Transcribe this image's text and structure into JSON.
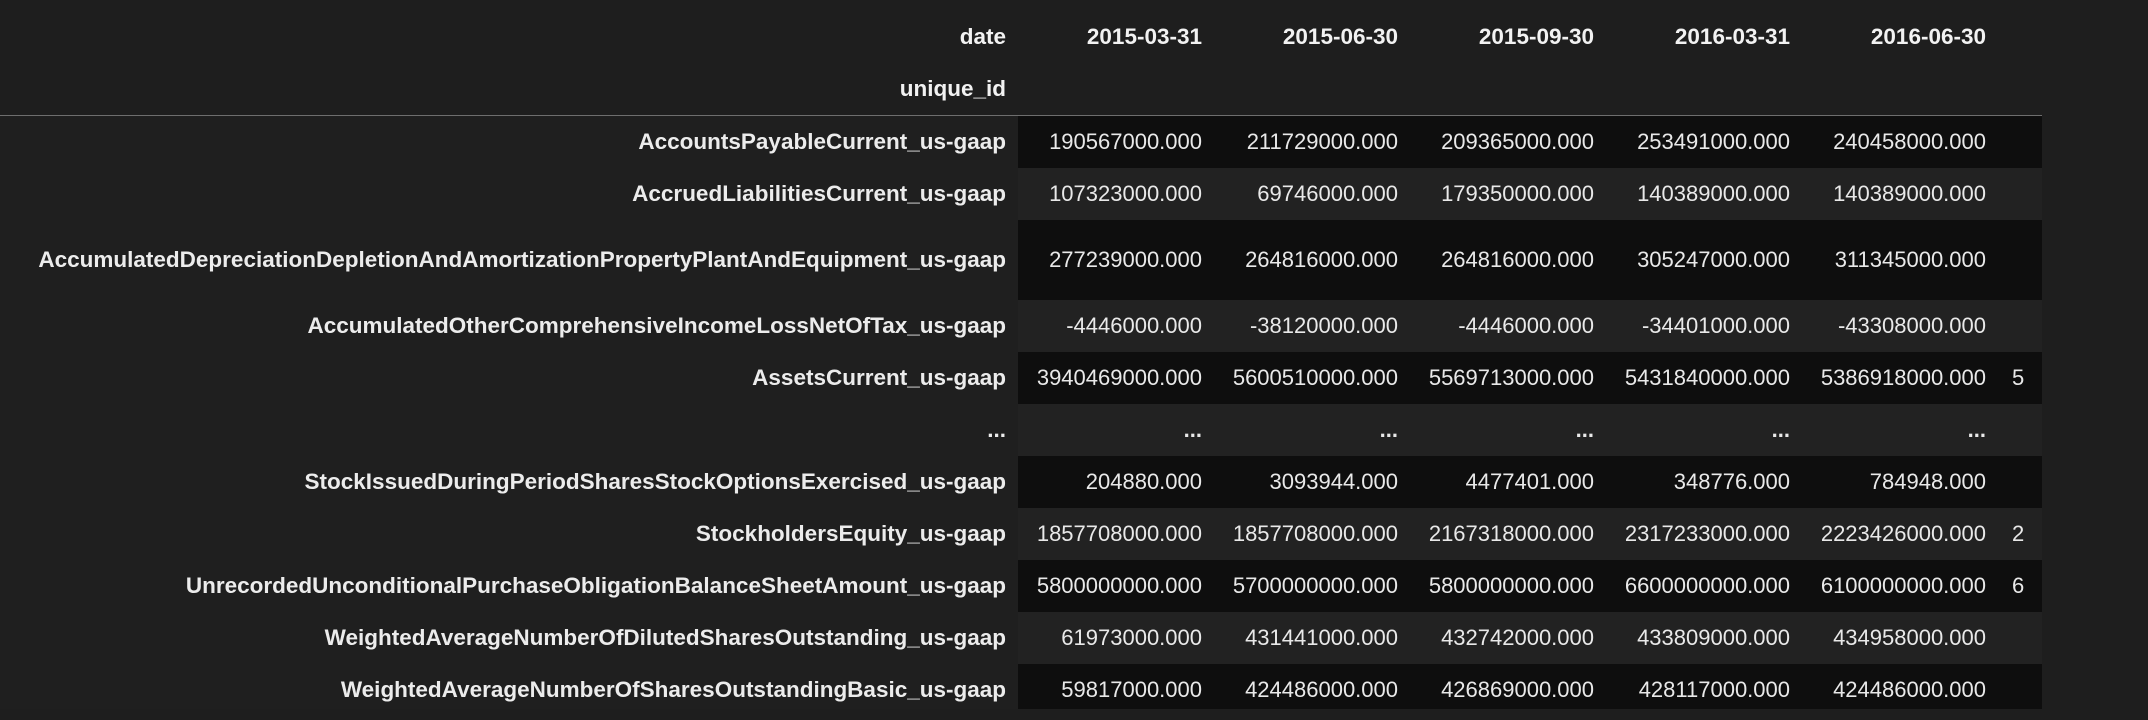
{
  "table": {
    "columns_name": "date",
    "index_name": "unique_id",
    "columns": [
      "2015-03-31",
      "2015-06-30",
      "2015-09-30",
      "2016-03-31",
      "2016-06-30"
    ],
    "rows": [
      {
        "label": "AccountsPayableCurrent_us-gaap",
        "values": [
          "190567000.000",
          "211729000.000",
          "209365000.000",
          "253491000.000",
          "240458000.000"
        ],
        "clipped": ""
      },
      {
        "label": "AccruedLiabilitiesCurrent_us-gaap",
        "values": [
          "107323000.000",
          "69746000.000",
          "179350000.000",
          "140389000.000",
          "140389000.000"
        ],
        "clipped": ""
      },
      {
        "label": "AccumulatedDepreciationDepletionAndAmortizationPropertyPlantAndEquipment_us-gaap",
        "values": [
          "277239000.000",
          "264816000.000",
          "264816000.000",
          "305247000.000",
          "311345000.000"
        ],
        "clipped": ""
      },
      {
        "label": "AccumulatedOtherComprehensiveIncomeLossNetOfTax_us-gaap",
        "values": [
          "-4446000.000",
          "-38120000.000",
          "-4446000.000",
          "-34401000.000",
          "-43308000.000"
        ],
        "clipped": ""
      },
      {
        "label": "AssetsCurrent_us-gaap",
        "values": [
          "3940469000.000",
          "5600510000.000",
          "5569713000.000",
          "5431840000.000",
          "5386918000.000"
        ],
        "clipped": "5"
      },
      {
        "label": "...",
        "values": [
          "...",
          "...",
          "...",
          "...",
          "..."
        ],
        "clipped": ""
      },
      {
        "label": "StockIssuedDuringPeriodSharesStockOptionsExercised_us-gaap",
        "values": [
          "204880.000",
          "3093944.000",
          "4477401.000",
          "348776.000",
          "784948.000"
        ],
        "clipped": ""
      },
      {
        "label": "StockholdersEquity_us-gaap",
        "values": [
          "1857708000.000",
          "1857708000.000",
          "2167318000.000",
          "2317233000.000",
          "2223426000.000"
        ],
        "clipped": "2"
      },
      {
        "label": "UnrecordedUnconditionalPurchaseObligationBalanceSheetAmount_us-gaap",
        "values": [
          "5800000000.000",
          "5700000000.000",
          "5800000000.000",
          "6600000000.000",
          "6100000000.000"
        ],
        "clipped": "6"
      },
      {
        "label": "WeightedAverageNumberOfDilutedSharesOutstanding_us-gaap",
        "values": [
          "61973000.000",
          "431441000.000",
          "432742000.000",
          "433809000.000",
          "434958000.000"
        ],
        "clipped": ""
      },
      {
        "label": "WeightedAverageNumberOfSharesOutstandingBasic_us-gaap",
        "values": [
          "59817000.000",
          "424486000.000",
          "426869000.000",
          "428117000.000",
          "424486000.000"
        ],
        "clipped": ""
      }
    ]
  }
}
